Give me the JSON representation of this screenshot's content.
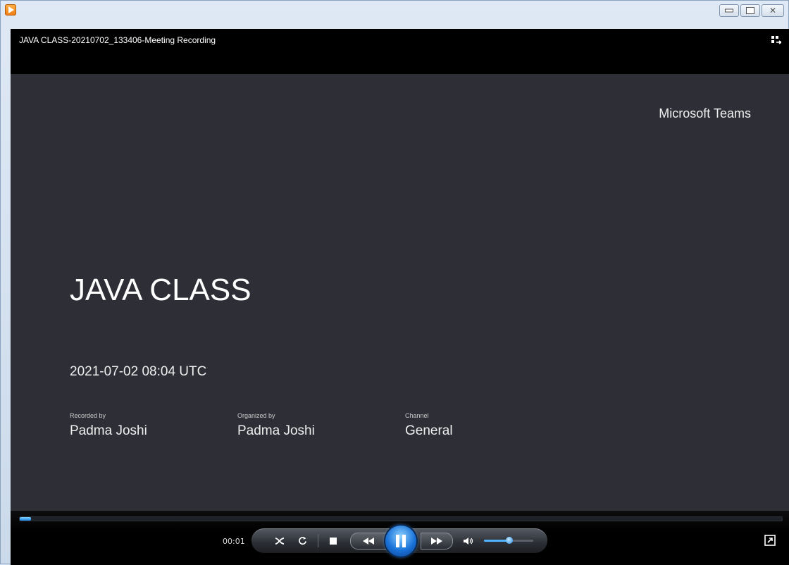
{
  "window": {
    "title": "JAVA CLASS-20210702_133406-Meeting Recording",
    "min_icon": "minimize-icon",
    "max_icon": "maximize-icon",
    "close_icon": "close-icon",
    "close_glyph": "✕"
  },
  "video": {
    "brand": "Microsoft Teams",
    "meeting_title": "JAVA CLASS",
    "date": "2021-07-02 08:04 UTC",
    "recorded_by_label": "Recorded by",
    "recorded_by": "Padma Joshi",
    "organized_by_label": "Organized by",
    "organized_by": "Padma Joshi",
    "channel_label": "Channel",
    "channel": "General",
    "background_color": "#2e2f36"
  },
  "player": {
    "elapsed": "00:01",
    "progress_fraction": 0.015,
    "volume_fraction": 0.52,
    "state": "playing",
    "icons": [
      "switch-view-icon",
      "shuffle-icon",
      "repeat-icon",
      "stop-icon",
      "previous-icon",
      "pause-icon",
      "next-icon",
      "volume-icon",
      "fullscreen-icon"
    ],
    "accent_color": "#1e88e5"
  }
}
